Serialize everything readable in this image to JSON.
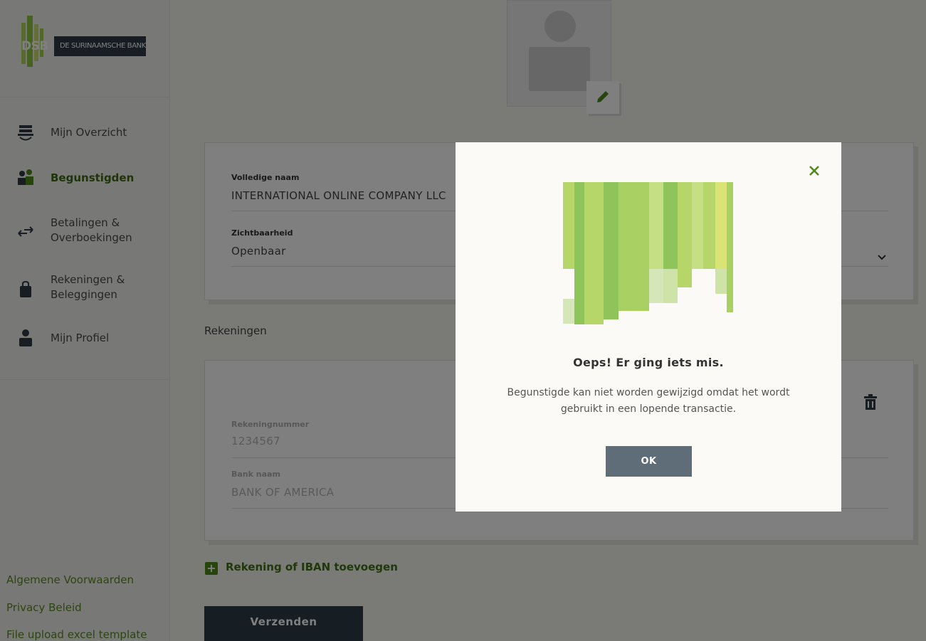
{
  "brand": {
    "logo_mark": "DSB",
    "logo_name": "DE SURINAAMSCHE BANK"
  },
  "sidebar": {
    "items": [
      {
        "label": "Mijn Overzicht",
        "icon": "overview-icon",
        "active": false
      },
      {
        "label": "Begunstigden",
        "icon": "beneficiaries-icon",
        "active": true
      },
      {
        "label": "Betalingen &\nOverboekingen",
        "icon": "transfer-arrows-icon",
        "active": false
      },
      {
        "label": "Rekeningen &\nBeleggingen",
        "icon": "bag-icon",
        "active": false
      },
      {
        "label": "Mijn Profiel",
        "icon": "profile-icon",
        "active": false
      }
    ],
    "footer_links": [
      "Algemene Voorwaarden",
      "Privacy Beleid",
      "File upload excel template"
    ]
  },
  "form": {
    "full_name_label": "Volledige naam",
    "full_name_value": "INTERNATIONAL ONLINE COMPANY LLC",
    "visibility_label": "Zichtbaarheid",
    "visibility_value": "Openbaar",
    "accounts_title": "Rekeningen",
    "account_number_label": "Rekeningnummer",
    "account_number_value": "1234567",
    "bank_name_label": "Bank naam",
    "bank_name_value": "BANK OF AMERICA",
    "add_account_label": "Rekening of IBAN toevoegen",
    "submit_label": "Verzenden"
  },
  "modal": {
    "title": "Oeps! Er ging iets mis.",
    "message": "Begunstigde kan niet worden gewijzigd omdat het wordt gebruikt in een lopende transactie.",
    "ok_label": "OK"
  },
  "colors": {
    "accent_green": "#4c8a1a",
    "dark_navy": "#2f3c46",
    "modal_button": "#5f6d78"
  }
}
